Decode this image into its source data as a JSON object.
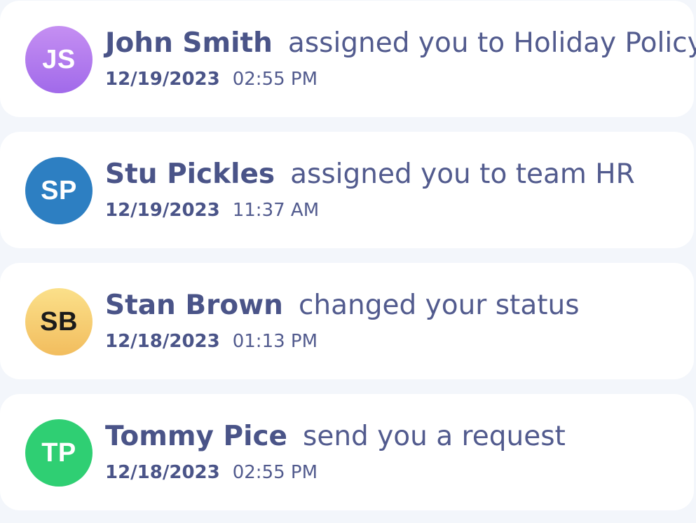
{
  "notifications": [
    {
      "initials": "JS",
      "name": "John Smith",
      "action": "assigned you to Holiday Policy",
      "date": "12/19/2023",
      "time": "02:55 PM",
      "avatar_color": "#b27cee"
    },
    {
      "initials": "SP",
      "name": "Stu Pickles",
      "action": "assigned you to team HR",
      "date": "12/19/2023",
      "time": "11:37 AM",
      "avatar_color": "#2d7fc2"
    },
    {
      "initials": "SB",
      "name": "Stan Brown",
      "action": "changed your status",
      "date": "12/18/2023",
      "time": "01:13 PM",
      "avatar_color": "#f6cd70"
    },
    {
      "initials": "TP",
      "name": "Tommy Pice",
      "action": "send you a request",
      "date": "12/18/2023",
      "time": "02:55 PM",
      "avatar_color": "#2fcf73"
    }
  ],
  "colors": {
    "background": "#f3f6fb",
    "card": "#ffffff",
    "text": "#4a5488"
  }
}
